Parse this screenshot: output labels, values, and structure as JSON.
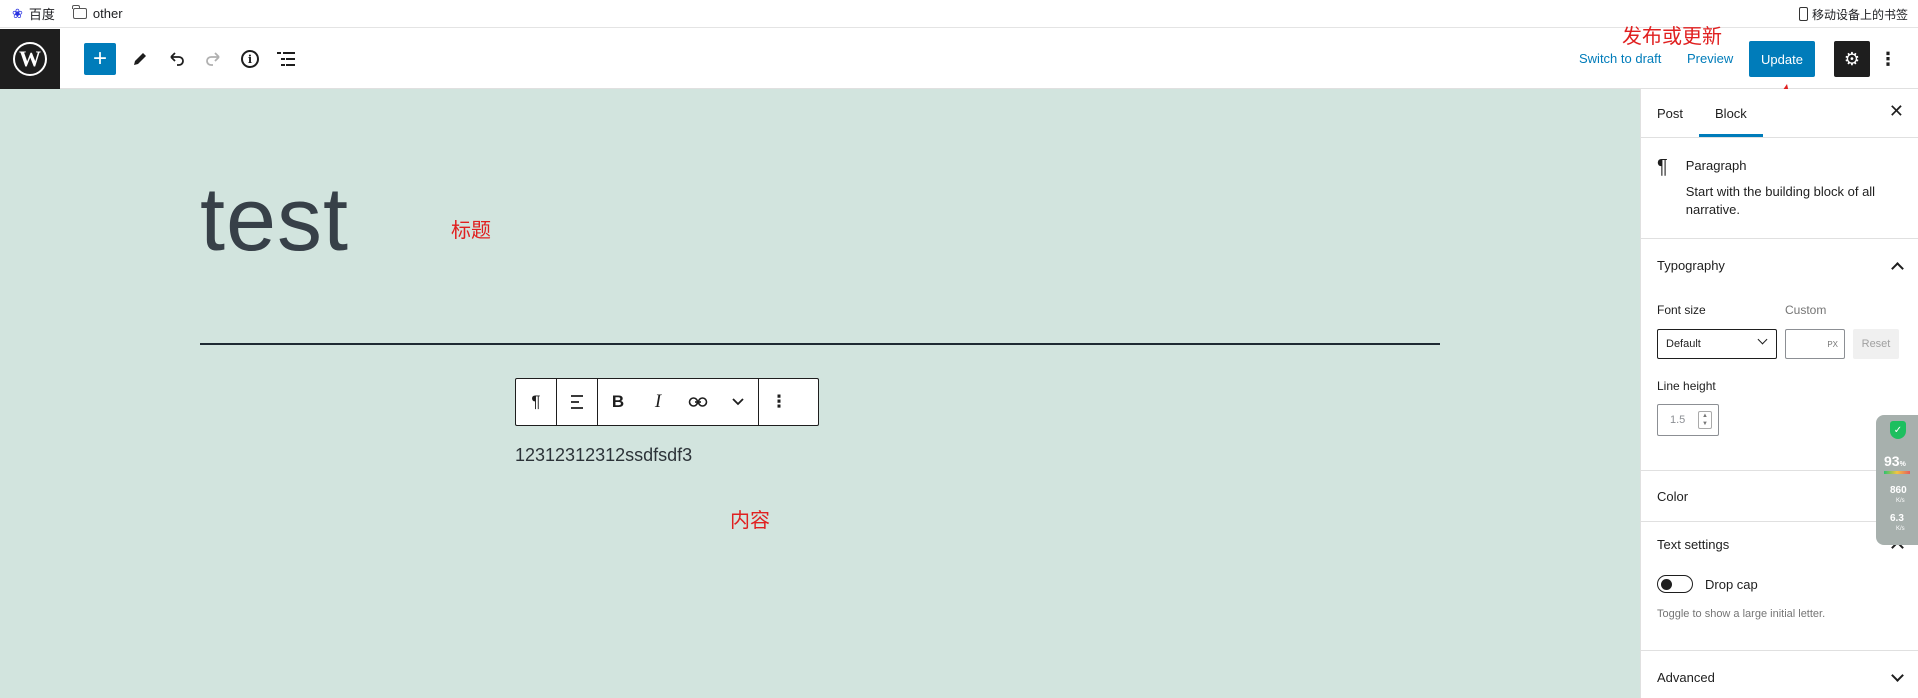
{
  "bookmarks": {
    "items": [
      {
        "label": "百度",
        "icon": "baidu-paw-icon"
      },
      {
        "label": "other",
        "icon": "folder-icon"
      }
    ],
    "mobile_label": "移动设备上的书签"
  },
  "header": {
    "switch_to_draft": "Switch to draft",
    "preview": "Preview",
    "update": "Update"
  },
  "editor": {
    "title": "test",
    "paragraph": "12312312312ssdfsdf3"
  },
  "annotations": {
    "title_note": "标题",
    "content_note": "内容",
    "publish_note": "发布或更新",
    "color": "#e02020"
  },
  "sidebar": {
    "tabs": [
      "Post",
      "Block"
    ],
    "active_tab": "Block",
    "block_card": {
      "title": "Paragraph",
      "description": "Start with the building block of all narrative."
    },
    "typography": {
      "heading": "Typography",
      "font_size_label": "Font size",
      "custom_label": "Custom",
      "font_size_value": "Default",
      "px_unit": "PX",
      "reset": "Reset",
      "line_height_label": "Line height",
      "line_height_placeholder": "1.5"
    },
    "color_heading": "Color",
    "text_settings": {
      "heading": "Text settings",
      "drop_cap_label": "Drop cap",
      "drop_cap_help": "Toggle to show a large initial letter."
    },
    "advanced_heading": "Advanced"
  },
  "widget": {
    "percent": "93",
    "percent_unit": "%",
    "up_speed": "860",
    "down_speed": "6.3",
    "unit": "K/s"
  },
  "colors": {
    "accent": "#007cba",
    "canvas_bg": "#d2e4de",
    "dark": "#1e1e1e"
  }
}
